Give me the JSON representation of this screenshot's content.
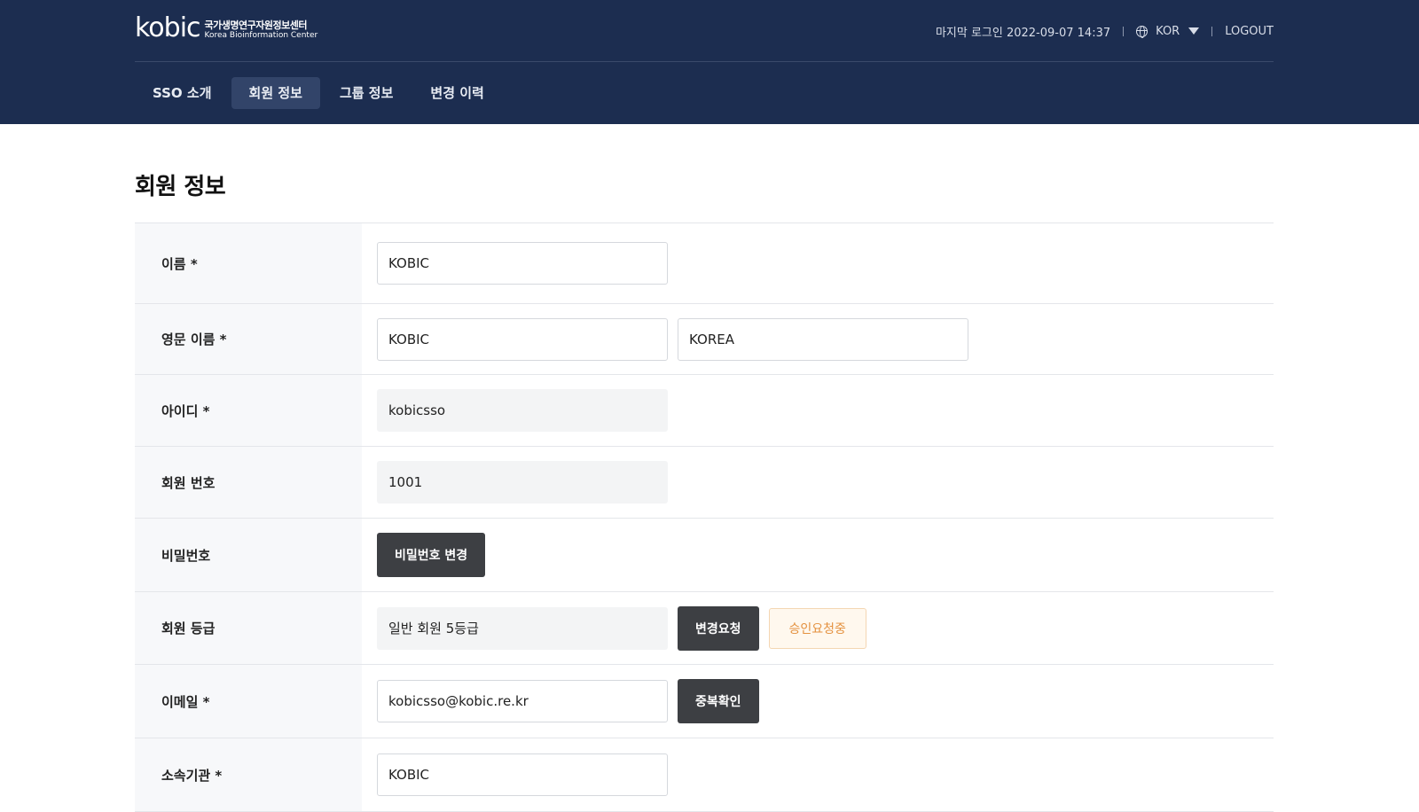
{
  "header": {
    "logo": {
      "mark": "kobic",
      "name_ko": "국가생명연구자원정보센터",
      "name_en": "Korea Bioinformation Center"
    },
    "last_login_label": "마지막 로그인 2022-09-07 14:37",
    "language": "KOR",
    "logout_label": "LOGOUT",
    "nav": [
      {
        "label": "SSO 소개",
        "active": false
      },
      {
        "label": "회원 정보",
        "active": true
      },
      {
        "label": "그룹 정보",
        "active": false
      },
      {
        "label": "변경 이력",
        "active": false
      }
    ]
  },
  "page": {
    "title": "회원 정보"
  },
  "form": {
    "name": {
      "label": "이름 *",
      "value": "KOBIC"
    },
    "english_name": {
      "label": "영문 이름 *",
      "first": "KOBIC",
      "last": "KOREA"
    },
    "user_id": {
      "label": "아이디 *",
      "value": "kobicsso"
    },
    "member_no": {
      "label": "회원 번호",
      "value": "1001"
    },
    "password": {
      "label": "비밀번호",
      "button": "비밀번호 변경"
    },
    "grade": {
      "label": "회원 등급",
      "value": "일반 회원 5등급",
      "button": "변경요청",
      "status": "승인요청중"
    },
    "email": {
      "label": "이메일 *",
      "value": "kobicsso@kobic.re.kr",
      "button": "중복확인"
    },
    "organization": {
      "label": "소속기관 *",
      "value": "KOBIC"
    }
  },
  "colors": {
    "header_bg": "#1c2d50",
    "nav_active_bg": "#324469",
    "dark_button": "#3d3f43",
    "pending_text": "#e4913f"
  }
}
